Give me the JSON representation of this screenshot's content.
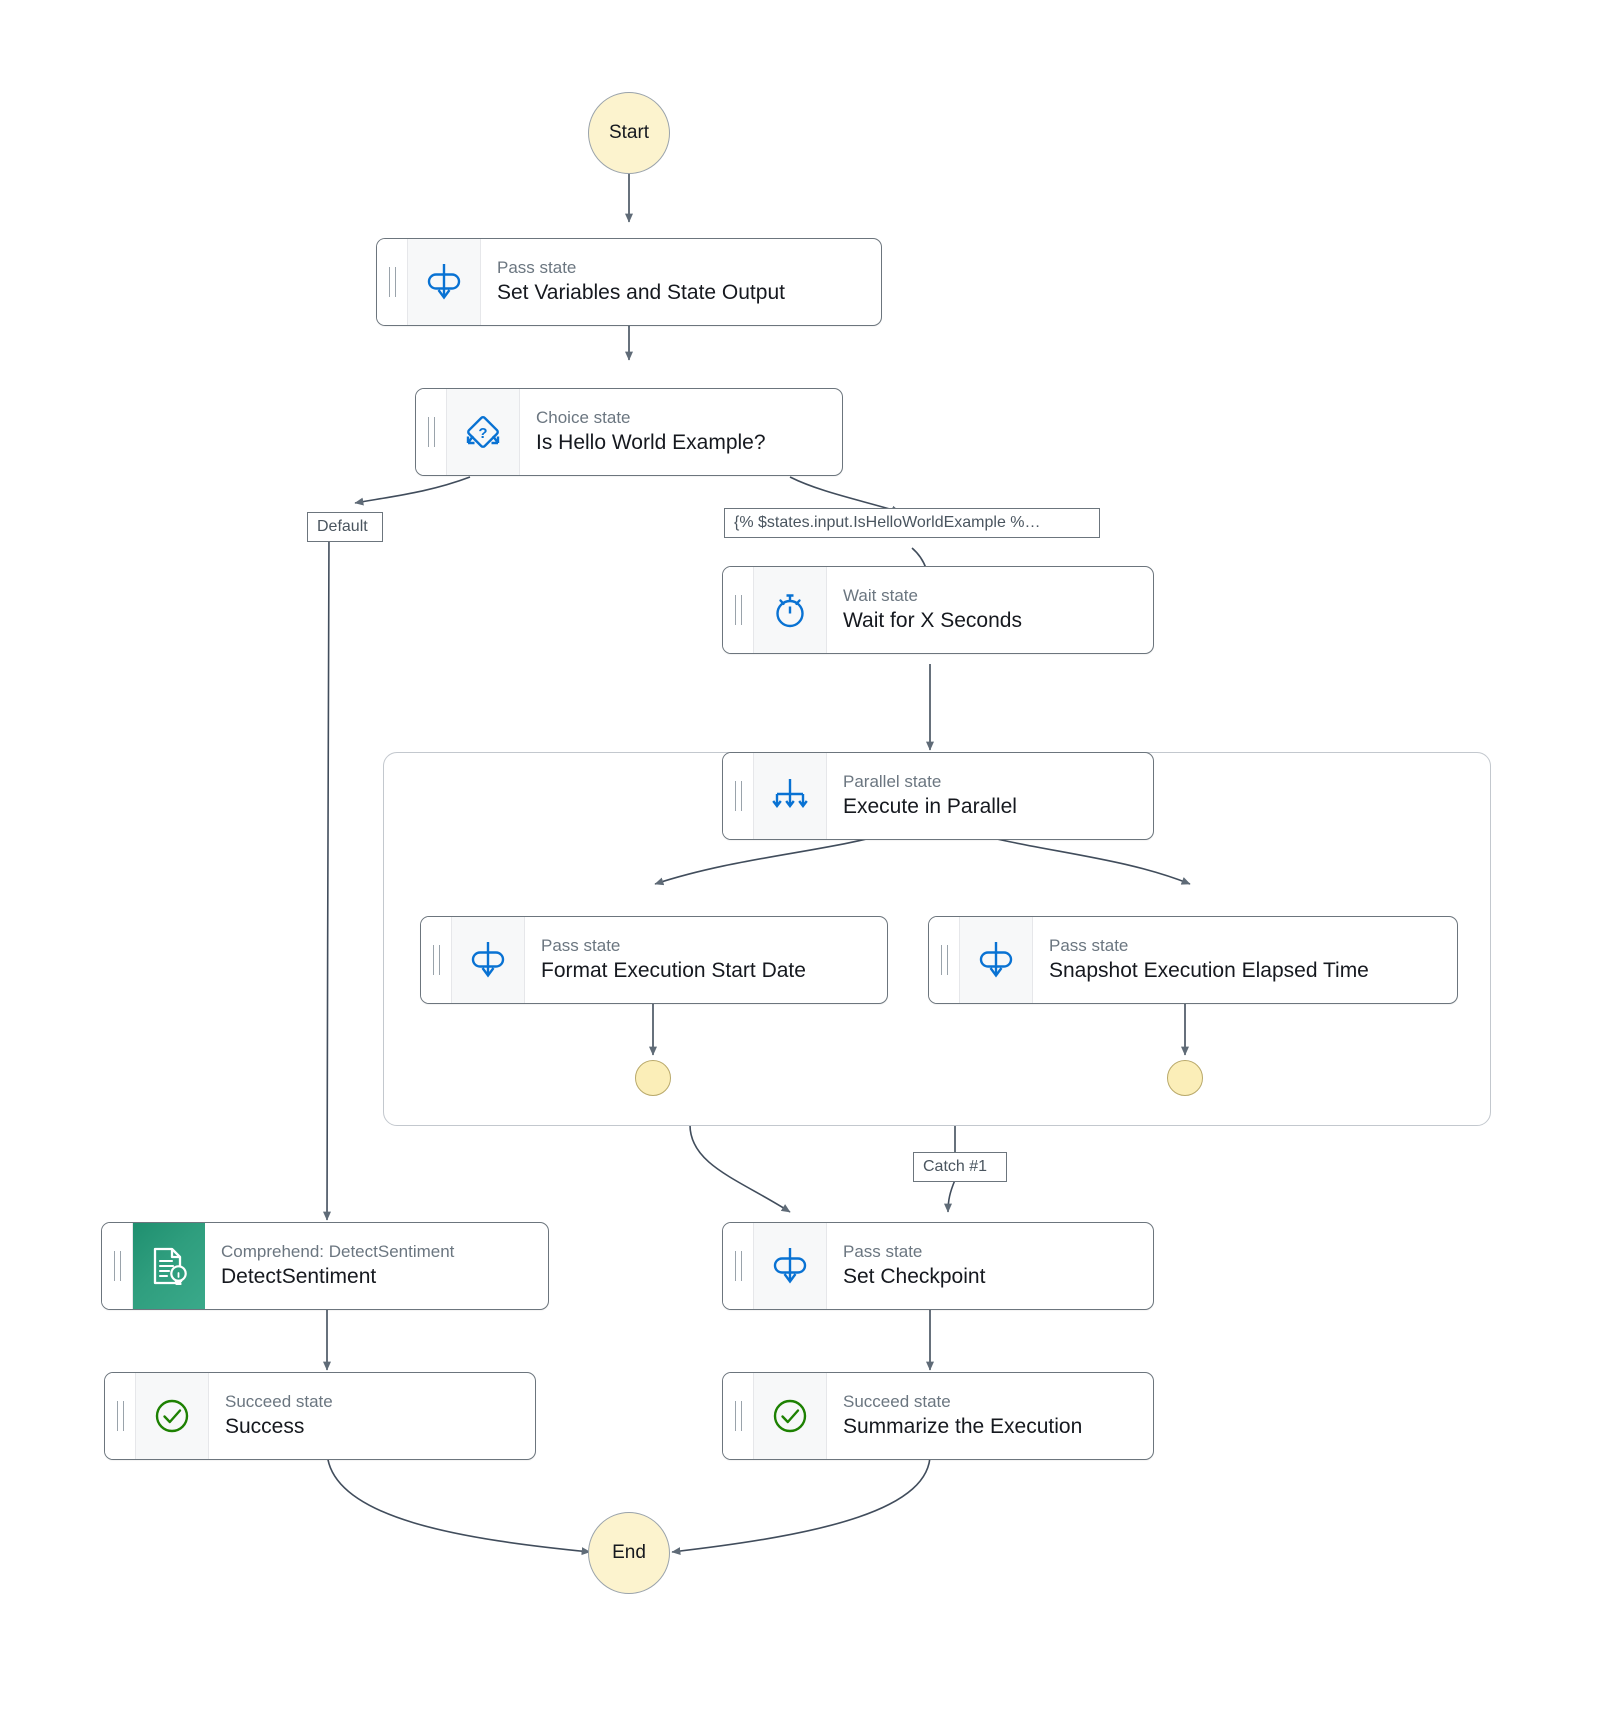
{
  "diagram": {
    "title": "AWS Step Functions state machine graph",
    "colors": {
      "terminal_fill": "#fcf3ce",
      "terminal_stroke": "#9aa3ab",
      "node_border": "#6c757d",
      "icon_blue": "#0972d3",
      "succeed_green": "#1d8102",
      "comprehend_teal": "#2f9e7e",
      "edge_stroke": "#414d5c",
      "kind_text": "#6b7680",
      "title_text": "#16191f"
    }
  },
  "terminals": {
    "start": {
      "label": "Start"
    },
    "end": {
      "label": "End"
    },
    "branch_end_left": {
      "label": ""
    },
    "branch_end_right": {
      "label": ""
    }
  },
  "nodes": [
    {
      "id": "set-variables",
      "kind": "Pass state",
      "title": "Set Variables and State Output",
      "icon": "pass-state-icon"
    },
    {
      "id": "is-hello-world",
      "kind": "Choice state",
      "title": "Is Hello World Example?",
      "icon": "choice-state-icon"
    },
    {
      "id": "wait-x-seconds",
      "kind": "Wait state",
      "title": "Wait for X Seconds",
      "icon": "wait-state-icon"
    },
    {
      "id": "execute-parallel",
      "kind": "Parallel state",
      "title": "Execute in Parallel",
      "icon": "parallel-state-icon"
    },
    {
      "id": "format-start",
      "kind": "Pass state",
      "title": "Format Execution Start Date",
      "icon": "pass-state-icon"
    },
    {
      "id": "snapshot-elapsed",
      "kind": "Pass state",
      "title": "Snapshot Execution Elapsed Time",
      "icon": "pass-state-icon"
    },
    {
      "id": "detect-sentiment",
      "kind": "Comprehend: DetectSentiment",
      "title": "DetectSentiment",
      "icon": "comprehend-icon"
    },
    {
      "id": "set-checkpoint",
      "kind": "Pass state",
      "title": "Set Checkpoint",
      "icon": "pass-state-icon"
    },
    {
      "id": "success",
      "kind": "Succeed state",
      "title": "Success",
      "icon": "succeed-state-icon"
    },
    {
      "id": "summarize",
      "kind": "Succeed state",
      "title": "Summarize the Execution",
      "icon": "succeed-state-icon"
    }
  ],
  "edge_labels": {
    "default": "Default",
    "condition": "{% $states.input.IsHelloWorldExample %…",
    "catch": "Catch #1"
  }
}
